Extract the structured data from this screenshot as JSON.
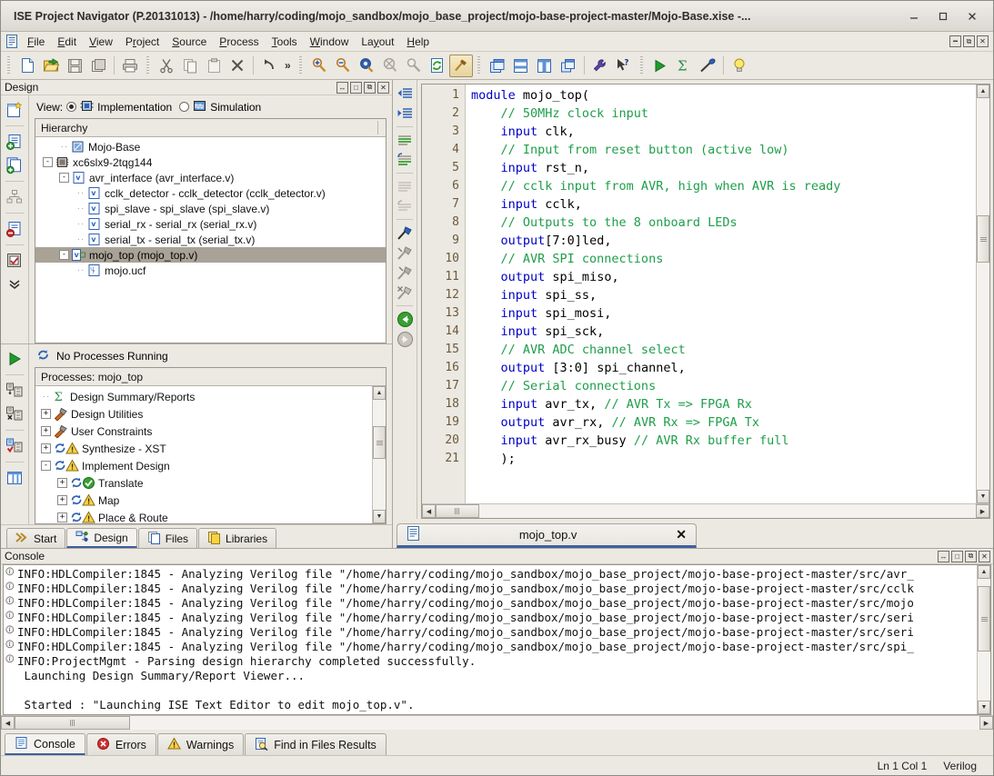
{
  "window": {
    "title": "ISE Project Navigator (P.20131013) - /home/harry/coding/mojo_sandbox/mojo_base_project/mojo-base-project-master/Mojo-Base.xise -...",
    "minimize_label": "–",
    "maximize_label": "□",
    "close_label": "✕"
  },
  "menubar": {
    "items": [
      {
        "label": "File",
        "accel": "F"
      },
      {
        "label": "Edit",
        "accel": "E"
      },
      {
        "label": "View",
        "accel": "V"
      },
      {
        "label": "Project",
        "accel": "r"
      },
      {
        "label": "Source",
        "accel": "S"
      },
      {
        "label": "Process",
        "accel": "P"
      },
      {
        "label": "Tools",
        "accel": "T"
      },
      {
        "label": "Window",
        "accel": "W"
      },
      {
        "label": "Layout",
        "accel": "y"
      },
      {
        "label": "Help",
        "accel": "H"
      }
    ],
    "mdi_buttons": [
      "minimize-mdi",
      "restore-mdi",
      "close-mdi"
    ]
  },
  "toolbar": {
    "groups": [
      [
        "new-file-icon",
        "open-project-icon",
        "save-icon",
        "save-all-icon"
      ],
      [
        "print-icon"
      ],
      [
        "cut-icon",
        "copy-icon",
        "paste-icon",
        "delete-icon"
      ],
      [
        "undo-icon"
      ],
      [
        "zoom-in-icon",
        "zoom-out-icon",
        "zoom-fit-icon",
        "zoom-select-icon",
        "zoom-region-icon",
        "refresh-icon",
        "build-icon"
      ],
      [
        "tile-horizontally-icon",
        "tile-vertically-icon",
        "panels-icon",
        "cascade-icon"
      ],
      [
        "settings-wrench-icon",
        "whats-this-help-icon"
      ],
      [
        "run-icon",
        "design-summary-icon",
        "impact-icon"
      ],
      [
        "tip-of-the-day-icon"
      ]
    ],
    "overflow_label": "»"
  },
  "design_panel": {
    "title": "Design",
    "buttons": [
      "dock-width-icon",
      "restore-panel-icon",
      "float-panel-icon",
      "close-panel-icon"
    ],
    "view_label": "View:",
    "view_options": [
      {
        "label": "Implementation",
        "selected": true,
        "icon": "chip-icon"
      },
      {
        "label": "Simulation",
        "selected": false,
        "icon": "waveform-icon"
      }
    ],
    "hierarchy_header": "Hierarchy",
    "hierarchy": [
      {
        "label": "Mojo-Base",
        "indent": 1,
        "expander": "",
        "icon": "project-icon",
        "selected": false
      },
      {
        "label": "xc6slx9-2tqg144",
        "indent": 0,
        "expander": "-",
        "icon": "device-icon",
        "selected": false
      },
      {
        "label": "avr_interface (avr_interface.v)",
        "indent": 1,
        "expander": "-",
        "icon": "verilog-icon",
        "selected": false
      },
      {
        "label": "cclk_detector - cclk_detector (cclk_detector.v)",
        "indent": 2,
        "expander": "",
        "icon": "verilog-icon",
        "selected": false
      },
      {
        "label": "spi_slave - spi_slave (spi_slave.v)",
        "indent": 2,
        "expander": "",
        "icon": "verilog-icon",
        "selected": false
      },
      {
        "label": "serial_rx - serial_rx (serial_rx.v)",
        "indent": 2,
        "expander": "",
        "icon": "verilog-icon",
        "selected": false
      },
      {
        "label": "serial_tx - serial_tx (serial_tx.v)",
        "indent": 2,
        "expander": "",
        "icon": "verilog-icon",
        "selected": false
      },
      {
        "label": "mojo_top (mojo_top.v)",
        "indent": 1,
        "expander": "-",
        "icon": "verilog-top-icon",
        "selected": true
      },
      {
        "label": "mojo.ucf",
        "indent": 2,
        "expander": "",
        "icon": "ucf-icon",
        "selected": false
      }
    ]
  },
  "processes_panel": {
    "no_processes_label": "No Processes Running",
    "header": "Processes: mojo_top",
    "items": [
      {
        "label": "Design Summary/Reports",
        "indent": 0,
        "expander": "",
        "icon": "sigma-icon",
        "status": ""
      },
      {
        "label": "Design Utilities",
        "indent": 0,
        "expander": "+",
        "icon": "utilities-icon",
        "status": ""
      },
      {
        "label": "User Constraints",
        "indent": 0,
        "expander": "+",
        "icon": "utilities-icon",
        "status": ""
      },
      {
        "label": "Synthesize - XST",
        "indent": 0,
        "expander": "+",
        "icon": "process-icon",
        "status": "warning"
      },
      {
        "label": "Implement Design",
        "indent": 0,
        "expander": "-",
        "icon": "process-icon",
        "status": "warning"
      },
      {
        "label": "Translate",
        "indent": 1,
        "expander": "+",
        "icon": "process-icon",
        "status": "ok"
      },
      {
        "label": "Map",
        "indent": 1,
        "expander": "+",
        "icon": "process-icon",
        "status": "warning"
      },
      {
        "label": "Place & Route",
        "indent": 1,
        "expander": "+",
        "icon": "process-icon",
        "status": "warning"
      }
    ]
  },
  "left_tabs": [
    {
      "label": "Start",
      "icon": "start-icon",
      "active": false
    },
    {
      "label": "Design",
      "icon": "design-icon",
      "active": true
    },
    {
      "label": "Files",
      "icon": "files-icon",
      "active": false
    },
    {
      "label": "Libraries",
      "icon": "libraries-icon",
      "active": false
    }
  ],
  "editor": {
    "tab": {
      "label": "mojo_top.v",
      "icon": "file-icon",
      "close_label": "✕"
    },
    "lines": [
      {
        "n": "1",
        "tokens": [
          {
            "t": "module ",
            "c": "kw"
          },
          {
            "t": "mojo_top(",
            "c": "pl"
          }
        ]
      },
      {
        "n": "2",
        "tokens": [
          {
            "t": "    // 50MHz clock input",
            "c": "cm"
          }
        ]
      },
      {
        "n": "3",
        "tokens": [
          {
            "t": "    ",
            "c": "pl"
          },
          {
            "t": "input",
            "c": "kw"
          },
          {
            "t": " clk,",
            "c": "pl"
          }
        ]
      },
      {
        "n": "4",
        "tokens": [
          {
            "t": "    // Input from reset button (active low)",
            "c": "cm"
          }
        ]
      },
      {
        "n": "5",
        "tokens": [
          {
            "t": "    ",
            "c": "pl"
          },
          {
            "t": "input",
            "c": "kw"
          },
          {
            "t": " rst_n,",
            "c": "pl"
          }
        ]
      },
      {
        "n": "6",
        "tokens": [
          {
            "t": "    // cclk input from AVR, high when AVR is ready",
            "c": "cm"
          }
        ]
      },
      {
        "n": "7",
        "tokens": [
          {
            "t": "    ",
            "c": "pl"
          },
          {
            "t": "input",
            "c": "kw"
          },
          {
            "t": " cclk,",
            "c": "pl"
          }
        ]
      },
      {
        "n": "8",
        "tokens": [
          {
            "t": "    // Outputs to the 8 onboard LEDs",
            "c": "cm"
          }
        ]
      },
      {
        "n": "9",
        "tokens": [
          {
            "t": "    ",
            "c": "pl"
          },
          {
            "t": "output",
            "c": "kw"
          },
          {
            "t": "[7:0]led,",
            "c": "pl"
          }
        ]
      },
      {
        "n": "10",
        "tokens": [
          {
            "t": "    // AVR SPI connections",
            "c": "cm"
          }
        ]
      },
      {
        "n": "11",
        "tokens": [
          {
            "t": "    ",
            "c": "pl"
          },
          {
            "t": "output",
            "c": "kw"
          },
          {
            "t": " spi_miso,",
            "c": "pl"
          }
        ]
      },
      {
        "n": "12",
        "tokens": [
          {
            "t": "    ",
            "c": "pl"
          },
          {
            "t": "input",
            "c": "kw"
          },
          {
            "t": " spi_ss,",
            "c": "pl"
          }
        ]
      },
      {
        "n": "13",
        "tokens": [
          {
            "t": "    ",
            "c": "pl"
          },
          {
            "t": "input",
            "c": "kw"
          },
          {
            "t": " spi_mosi,",
            "c": "pl"
          }
        ]
      },
      {
        "n": "14",
        "tokens": [
          {
            "t": "    ",
            "c": "pl"
          },
          {
            "t": "input",
            "c": "kw"
          },
          {
            "t": " spi_sck,",
            "c": "pl"
          }
        ]
      },
      {
        "n": "15",
        "tokens": [
          {
            "t": "    // AVR ADC channel select",
            "c": "cm"
          }
        ]
      },
      {
        "n": "16",
        "tokens": [
          {
            "t": "    ",
            "c": "pl"
          },
          {
            "t": "output",
            "c": "kw"
          },
          {
            "t": " [3:0] spi_channel,",
            "c": "pl"
          }
        ]
      },
      {
        "n": "17",
        "tokens": [
          {
            "t": "    // Serial connections",
            "c": "cm"
          }
        ]
      },
      {
        "n": "18",
        "tokens": [
          {
            "t": "    ",
            "c": "pl"
          },
          {
            "t": "input",
            "c": "kw"
          },
          {
            "t": " avr_tx, ",
            "c": "pl"
          },
          {
            "t": "// AVR Tx => FPGA Rx",
            "c": "cm"
          }
        ]
      },
      {
        "n": "19",
        "tokens": [
          {
            "t": "    ",
            "c": "pl"
          },
          {
            "t": "output",
            "c": "kw"
          },
          {
            "t": " avr_rx, ",
            "c": "pl"
          },
          {
            "t": "// AVR Rx => FPGA Tx",
            "c": "cm"
          }
        ]
      },
      {
        "n": "20",
        "tokens": [
          {
            "t": "    ",
            "c": "pl"
          },
          {
            "t": "input",
            "c": "kw"
          },
          {
            "t": " avr_rx_busy ",
            "c": "pl"
          },
          {
            "t": "// AVR Rx buffer full",
            "c": "cm"
          }
        ]
      },
      {
        "n": "21",
        "tokens": [
          {
            "t": "    );",
            "c": "pl"
          }
        ]
      }
    ]
  },
  "console_panel": {
    "title": "Console",
    "buttons": [
      "dock-width-icon",
      "restore-panel-icon",
      "float-panel-icon",
      "close-panel-icon"
    ],
    "lines": [
      {
        "icon": "info-icon",
        "text": "INFO:HDLCompiler:1845 - Analyzing Verilog file \"/home/harry/coding/mojo_sandbox/mojo_base_project/mojo-base-project-master/src/avr_"
      },
      {
        "icon": "info-icon",
        "text": "INFO:HDLCompiler:1845 - Analyzing Verilog file \"/home/harry/coding/mojo_sandbox/mojo_base_project/mojo-base-project-master/src/cclk"
      },
      {
        "icon": "info-icon",
        "text": "INFO:HDLCompiler:1845 - Analyzing Verilog file \"/home/harry/coding/mojo_sandbox/mojo_base_project/mojo-base-project-master/src/mojo"
      },
      {
        "icon": "info-icon",
        "text": "INFO:HDLCompiler:1845 - Analyzing Verilog file \"/home/harry/coding/mojo_sandbox/mojo_base_project/mojo-base-project-master/src/seri"
      },
      {
        "icon": "info-icon",
        "text": "INFO:HDLCompiler:1845 - Analyzing Verilog file \"/home/harry/coding/mojo_sandbox/mojo_base_project/mojo-base-project-master/src/seri"
      },
      {
        "icon": "info-icon",
        "text": "INFO:HDLCompiler:1845 - Analyzing Verilog file \"/home/harry/coding/mojo_sandbox/mojo_base_project/mojo-base-project-master/src/spi_"
      },
      {
        "icon": "info-icon",
        "text": "INFO:ProjectMgmt - Parsing design hierarchy completed successfully."
      },
      {
        "icon": "",
        "text": " Launching Design Summary/Report Viewer..."
      },
      {
        "icon": "",
        "text": ""
      },
      {
        "icon": "",
        "text": " Started : \"Launching ISE Text Editor to edit mojo_top.v\"."
      }
    ]
  },
  "bottom_tabs": [
    {
      "label": "Console",
      "icon": "console-icon",
      "active": true
    },
    {
      "label": "Errors",
      "icon": "error-icon",
      "active": false
    },
    {
      "label": "Warnings",
      "icon": "warning-icon",
      "active": false
    },
    {
      "label": "Find in Files Results",
      "icon": "find-icon",
      "active": false
    }
  ],
  "statusbar": {
    "position": "Ln 1 Col 1",
    "language": "Verilog"
  }
}
